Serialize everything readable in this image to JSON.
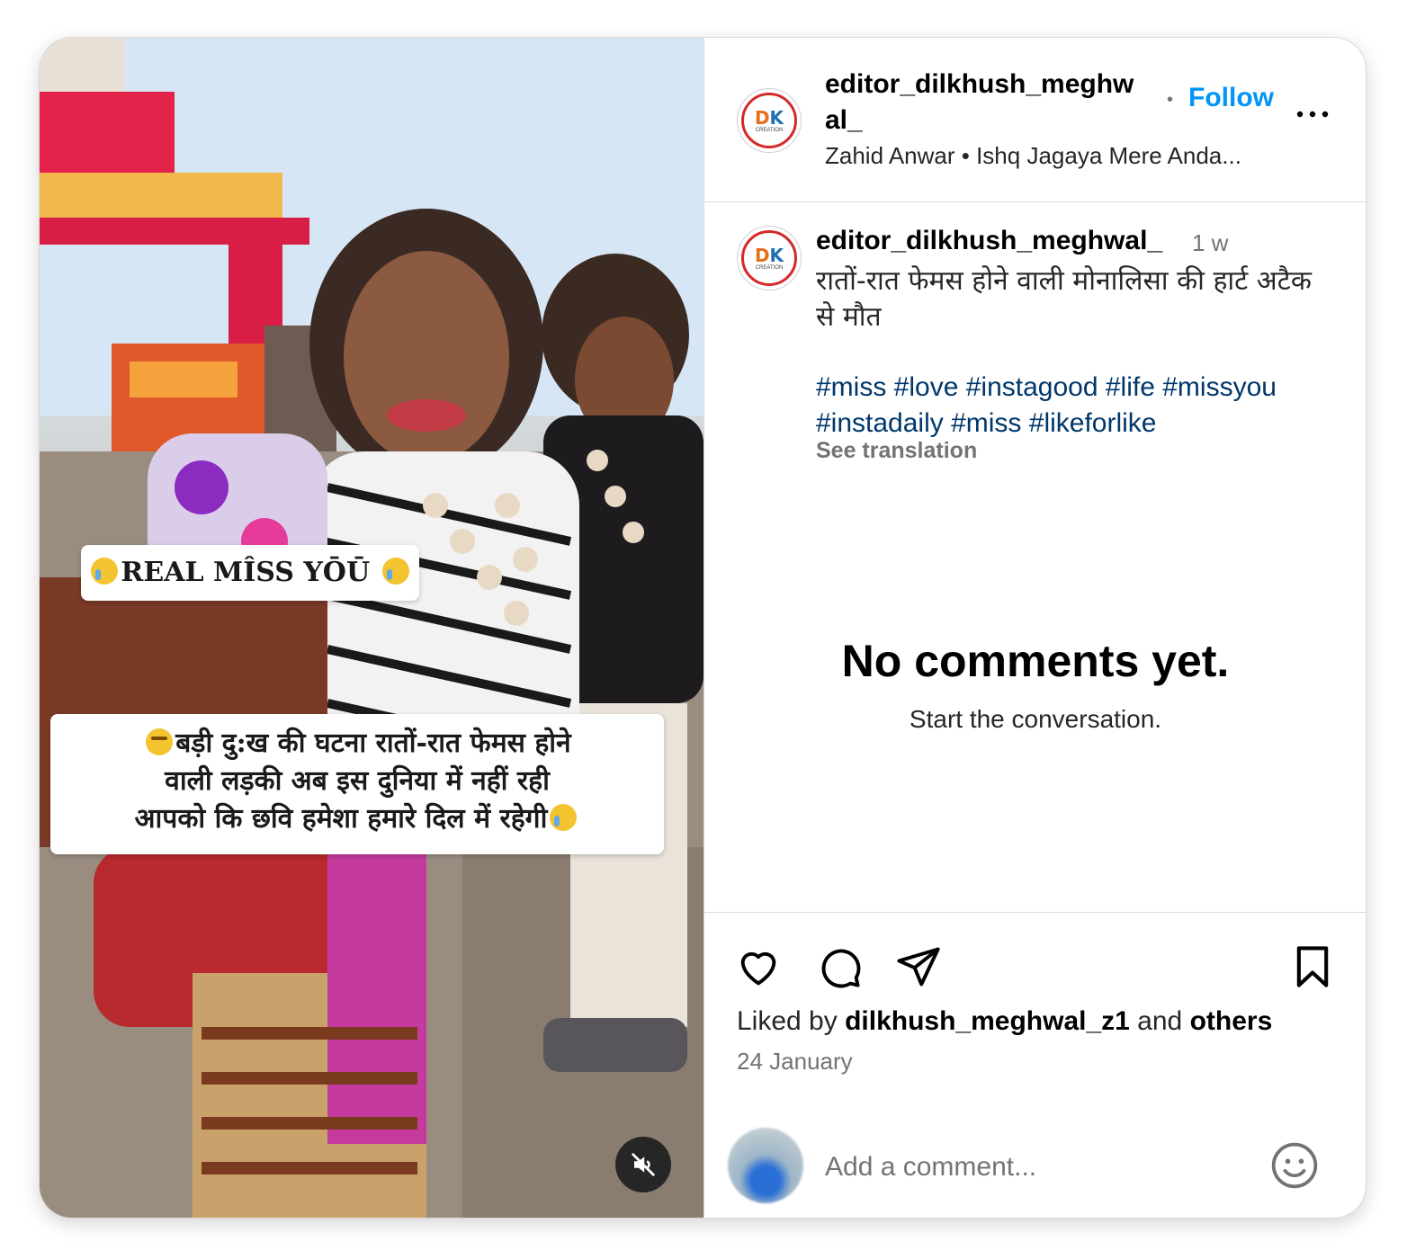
{
  "post": {
    "header": {
      "username": "editor_dilkhush_meghwal_",
      "follow_label": "Follow",
      "audio": "Zahid Anwar • Ishq Jagaya Mere Anda..."
    },
    "avatar": {
      "initial_d": "D",
      "initial_k": "K",
      "subtitle": "CREATION"
    },
    "caption": {
      "username": "editor_dilkhush_meghwal_",
      "time": "1 w",
      "text": "रातों-रात फेमस होने वाली मोनालिसा की हार्ट अटैक से मौत",
      "hashtags": "#miss #love #instagood #life #missyou #instadaily #miss #likeforlike",
      "translate_label": "See translation"
    },
    "comments": {
      "empty_title": "No comments yet.",
      "empty_subtitle": "Start the conversation."
    },
    "likes": {
      "prefix": "Liked by ",
      "user": "dilkhush_meghwal_z1",
      "middle": " and ",
      "others": "others"
    },
    "date": "24 January",
    "comment_input": {
      "placeholder": "Add a comment..."
    }
  },
  "media": {
    "overlay_1": "REAL MÎSS YŌŪ",
    "overlay_2_lines": [
      "बड़ी दु:ख की घटना रातों-रात फेमस होने",
      "वाली लड़की अब इस दुनिया में नहीं रही",
      "आपको कि छवि हमेशा हमारे दिल में रहेगी"
    ],
    "muted": true
  },
  "icons": {
    "like": "heart-icon",
    "comment": "comment-icon",
    "share": "paper-plane-icon",
    "save": "bookmark-icon",
    "more": "more-icon",
    "mute": "speaker-muted-icon",
    "emoji": "smiley-icon"
  },
  "colors": {
    "accent": "#0095f6",
    "hashtag": "#00376b",
    "muted_text": "#737373"
  }
}
